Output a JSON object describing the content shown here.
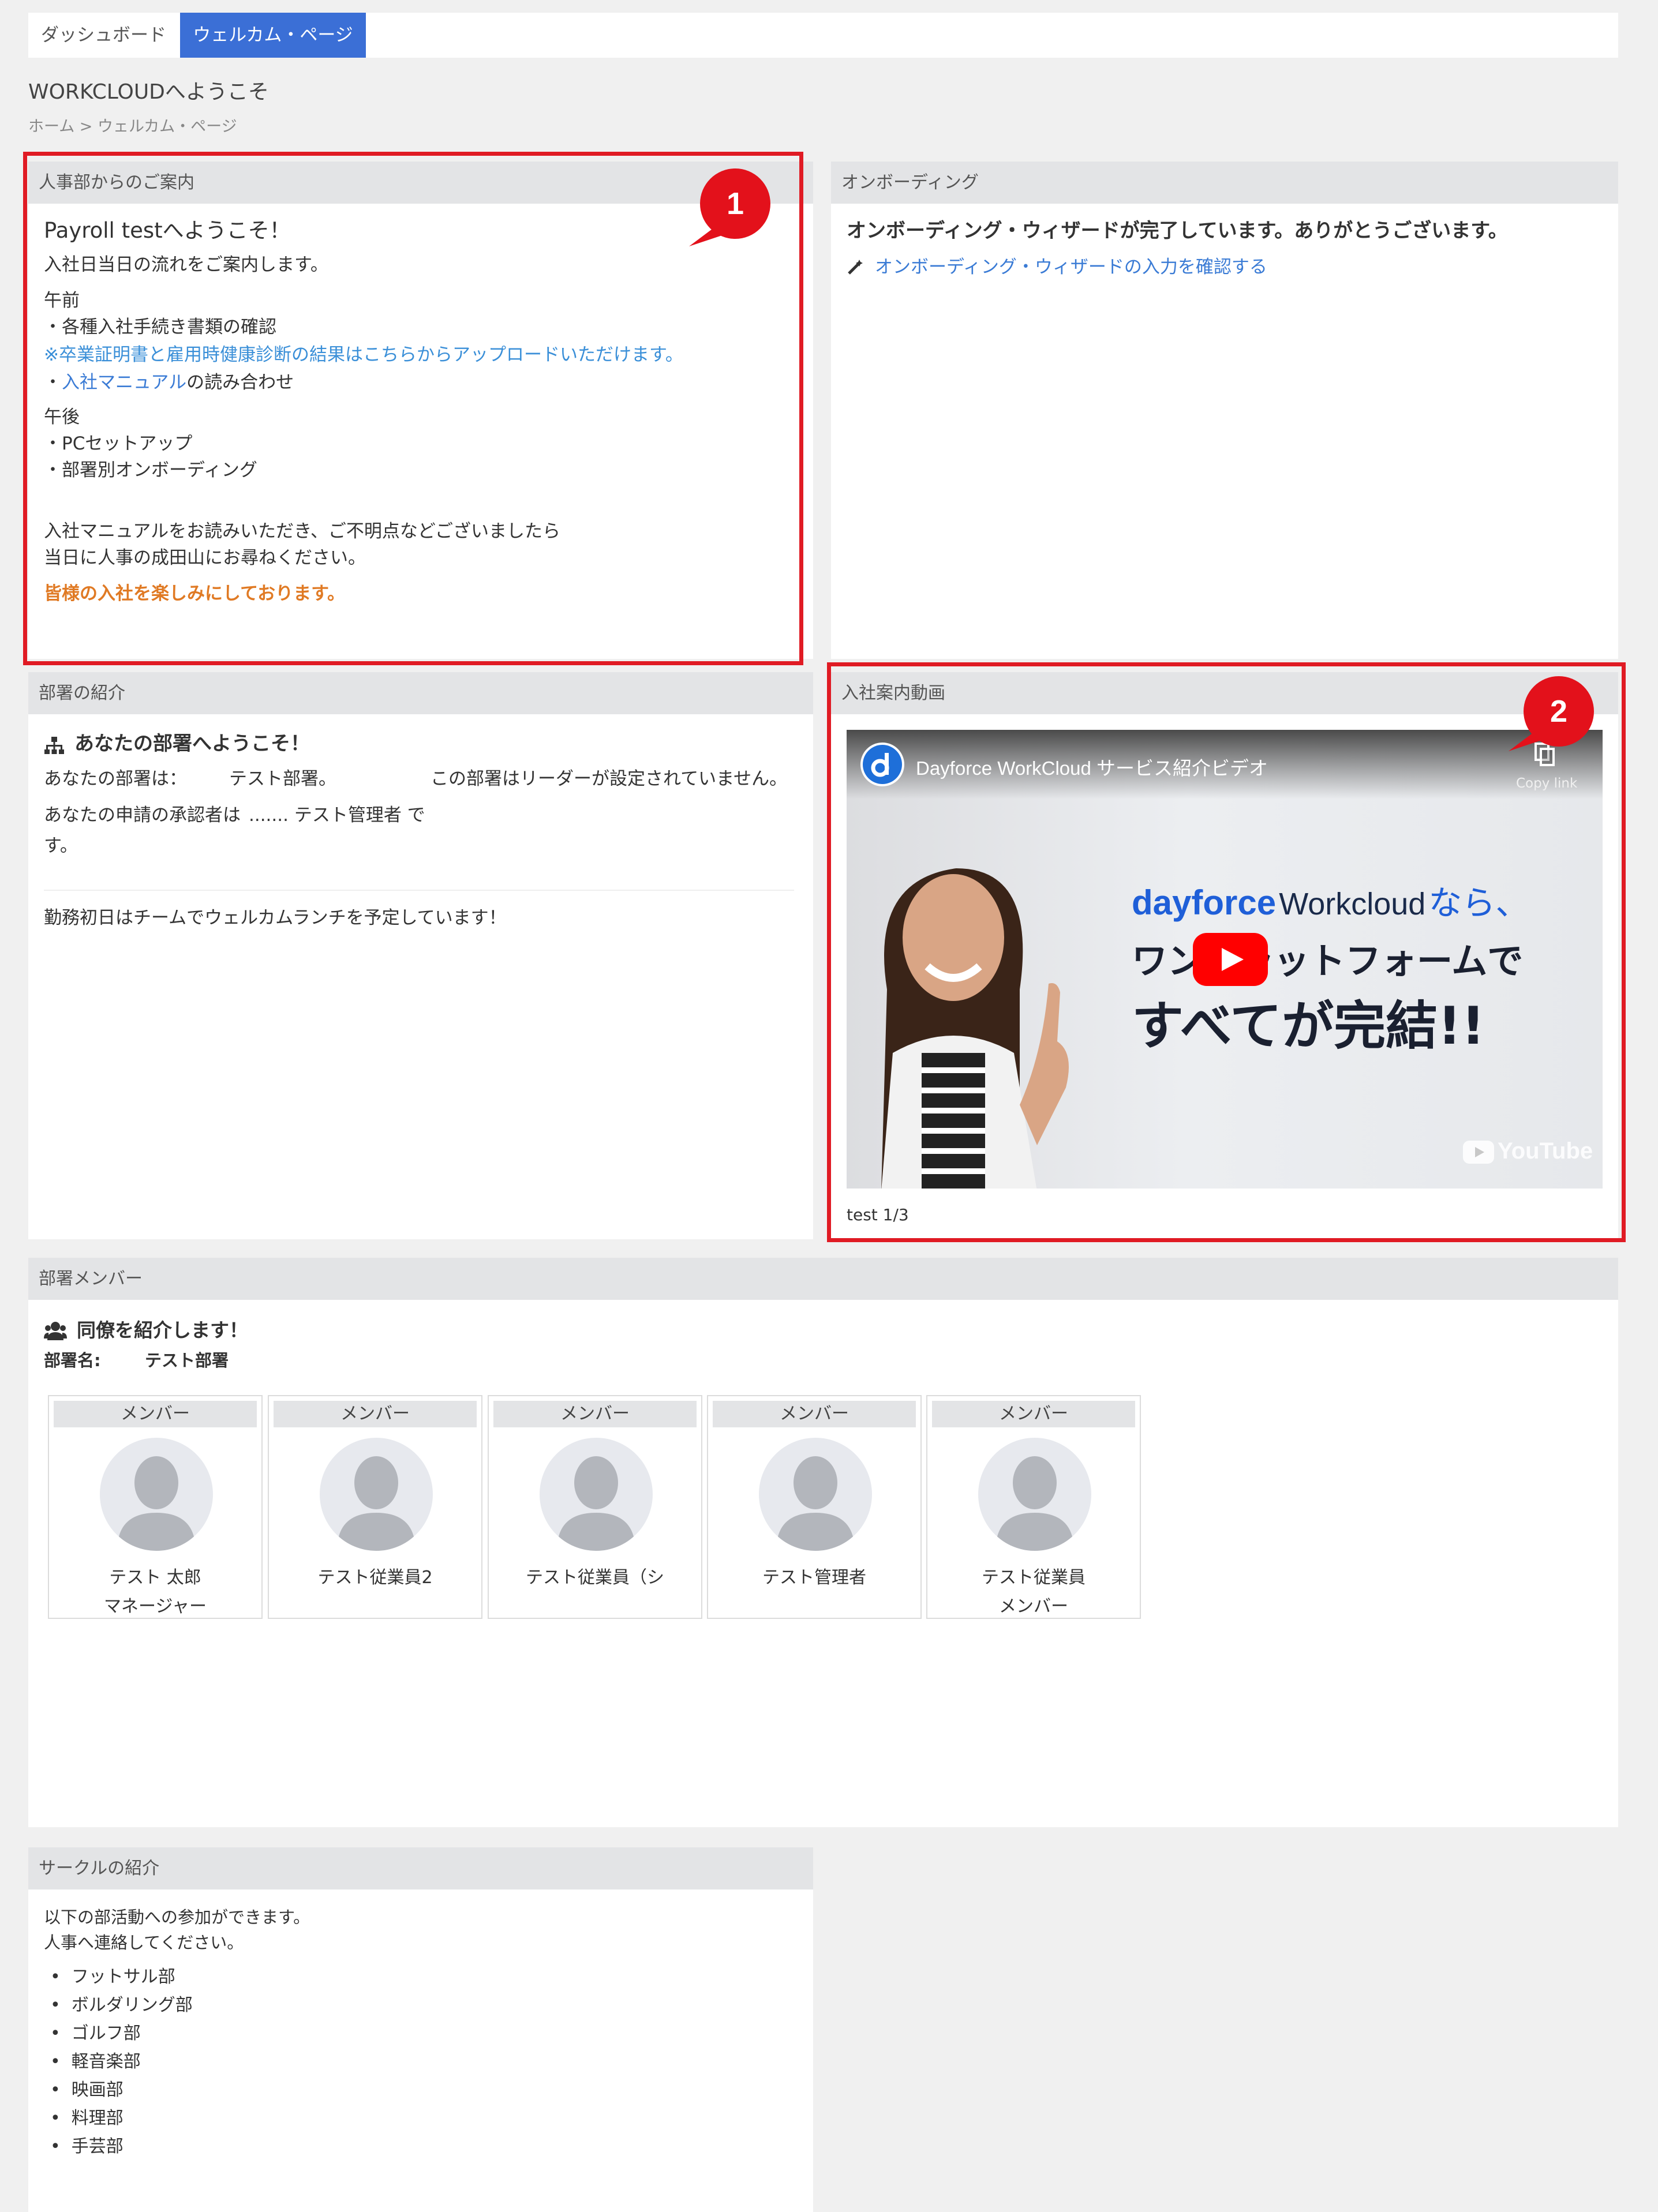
{
  "tabs": {
    "dashboard": "ダッシュボード",
    "welcome": "ウェルカム・ページ"
  },
  "page_title": "WORKCLOUDへようこそ",
  "breadcrumb": "ホーム > ウェルカム・ページ",
  "hr_panel": {
    "header": "人事部からのご案内",
    "greeting": "Payroll testへようこそ！",
    "intro": "入社日当日の流れをご案内します。",
    "morning": "午前",
    "morning_item1": "・各種入社手続き書類の確認",
    "morning_note": "※卒業証明書と雇用時健康診断の結果はこちらからアップロードいただけます。",
    "morning_item2_prefix": "・",
    "morning_item2_link": "入社マニュアル",
    "morning_item2_suffix": "の読み合わせ",
    "afternoon": "午後",
    "afternoon_item1": "・PCセットアップ",
    "afternoon_item2": "・部署別オンボーディング",
    "closing1": "入社マニュアルをお読みいただき、ご不明点などございましたら",
    "closing2": "当日に人事の成田山にお尋ねください。",
    "highlight": "皆様の入社を楽しみにしております。"
  },
  "onboarding_panel": {
    "header": "オンボーディング",
    "message": "オンボーディング・ウィザードが完了しています。ありがとうございます。",
    "link": "オンボーディング・ウィザードの入力を確認する"
  },
  "dept_panel": {
    "header": "部署の紹介",
    "heading": "あなたの部署へようこそ！",
    "dept_label": "あなたの部署は：",
    "dept_value": "テスト部署。",
    "no_leader": "この部署はリーダーが設定されていません。",
    "approver_label": "あなたの申請の承認者は",
    "approver_value": "....... テスト管理者 で",
    "approver_end": "す。",
    "lunch": "勤務初日はチームでウェルカムランチを予定しています！"
  },
  "video_panel": {
    "header": "入社案内動画",
    "video_title": "Dayforce WorkCloud サービス紹介ビデオ",
    "copy_link": "Copy link",
    "brand_dayforce": "dayforce",
    "brand_workcloud": "Workcloud",
    "headline1": "なら、",
    "headline2": "ワンプラットフォームで",
    "headline3": "すべてが完結!!",
    "youtube": "YouTube",
    "caption": "test 1/3"
  },
  "members_panel": {
    "header": "部署メンバー",
    "heading": "同僚を紹介します！",
    "dept_label": "部署名:",
    "dept_name": "テスト部署",
    "members": [
      {
        "role": "メンバー",
        "name": "テスト 太郎",
        "title": "マネージャー"
      },
      {
        "role": "メンバー",
        "name": "テスト従業員2",
        "title": ""
      },
      {
        "role": "メンバー",
        "name": "テスト従業員（シ",
        "title": ""
      },
      {
        "role": "メンバー",
        "name": "テスト管理者",
        "title": ""
      },
      {
        "role": "メンバー",
        "name": "テスト従業員",
        "title": "メンバー"
      }
    ]
  },
  "circles_panel": {
    "header": "サークルの紹介",
    "line1": "以下の部活動への参加ができます。",
    "line2": "人事へ連絡してください。",
    "items": [
      "フットサル部",
      "ボルダリング部",
      "ゴルフ部",
      "軽音楽部",
      "映画部",
      "料理部",
      "手芸部"
    ]
  },
  "callouts": {
    "one": "1",
    "two": "2"
  },
  "colors": {
    "accent": "#3b6fd6",
    "highlight_box": "#e01b24",
    "orange": "#e07a24",
    "link": "#3a7bd5"
  }
}
